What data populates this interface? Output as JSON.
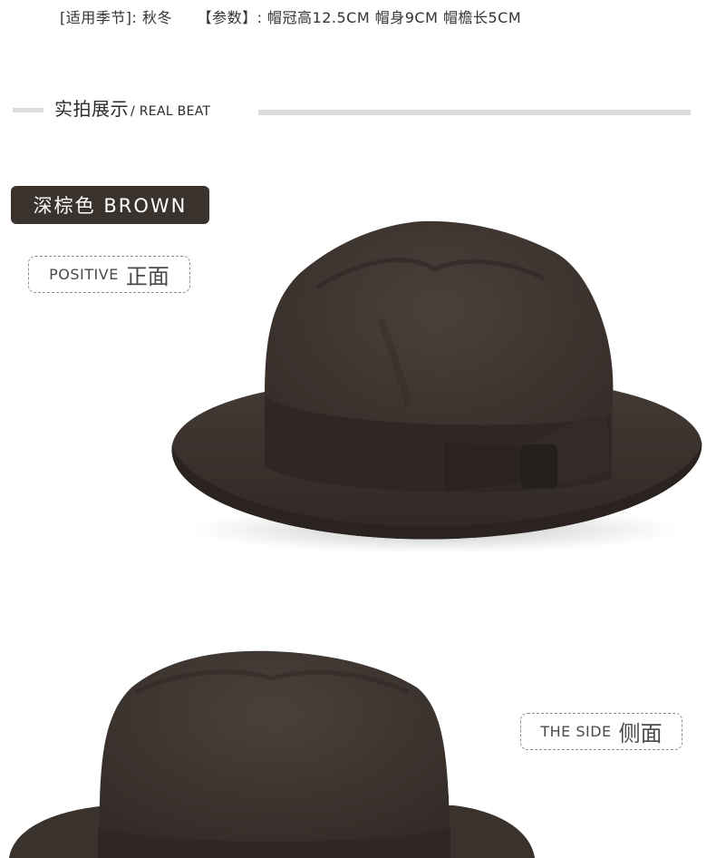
{
  "specs": {
    "season": "[适用季节]: 秋冬",
    "params": "【参数】: 帽冠高12.5CM 帽身9CM 帽檐长5CM"
  },
  "section": {
    "title_cn": "实拍展示",
    "title_en": "/ REAL BEAT"
  },
  "color_badge": {
    "label": "深棕色 BROWN"
  },
  "views": {
    "front": {
      "en": "POSITIVE",
      "cn": "正面"
    },
    "side": {
      "en": "THE SIDE",
      "cn": "侧面"
    }
  },
  "colors": {
    "hat_felt": "#3d3530",
    "hat_band": "#2e2723",
    "badge_bg": "#3a322d",
    "divider": "#dcdcdc"
  },
  "images": {
    "front": "brown-fedora-hat-front-view",
    "side": "brown-fedora-hat-side-view"
  }
}
